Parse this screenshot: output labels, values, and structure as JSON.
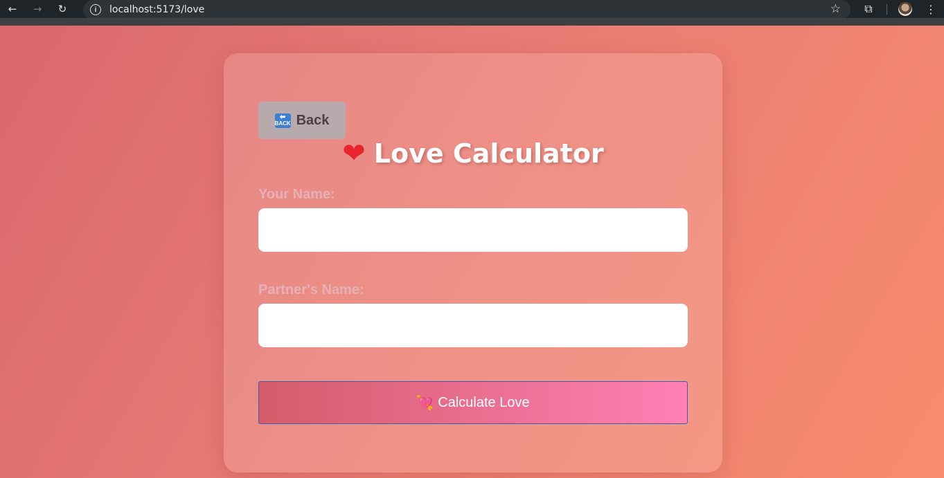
{
  "browser": {
    "url": "localhost:5173/love",
    "back_glyph": "←",
    "forward_glyph": "→",
    "reload_glyph": "↻",
    "info_glyph": "i",
    "star_glyph": "☆",
    "extensions_glyph": "⧉",
    "menu_glyph": "⋮"
  },
  "page": {
    "back_button": {
      "icon": "back-arrow-emoji-icon",
      "icon_text": "BACK",
      "label": "Back"
    },
    "title": {
      "icon": "red-heart-icon",
      "icon_glyph": "❤",
      "text": "Love Calculator"
    },
    "form": {
      "your_name_label": "Your Name:",
      "your_name_value": "",
      "partner_name_label": "Partner's Name:",
      "partner_name_value": "",
      "submit_icon": "heart-with-arrow-icon",
      "submit_icon_glyph": "💘",
      "submit_label": "Calculate Love"
    }
  },
  "colors": {
    "background_start": "#d9686f",
    "background_end": "#f78c6e",
    "button_gradient_start": "#d45c6a",
    "button_gradient_end": "#ff80b5"
  }
}
